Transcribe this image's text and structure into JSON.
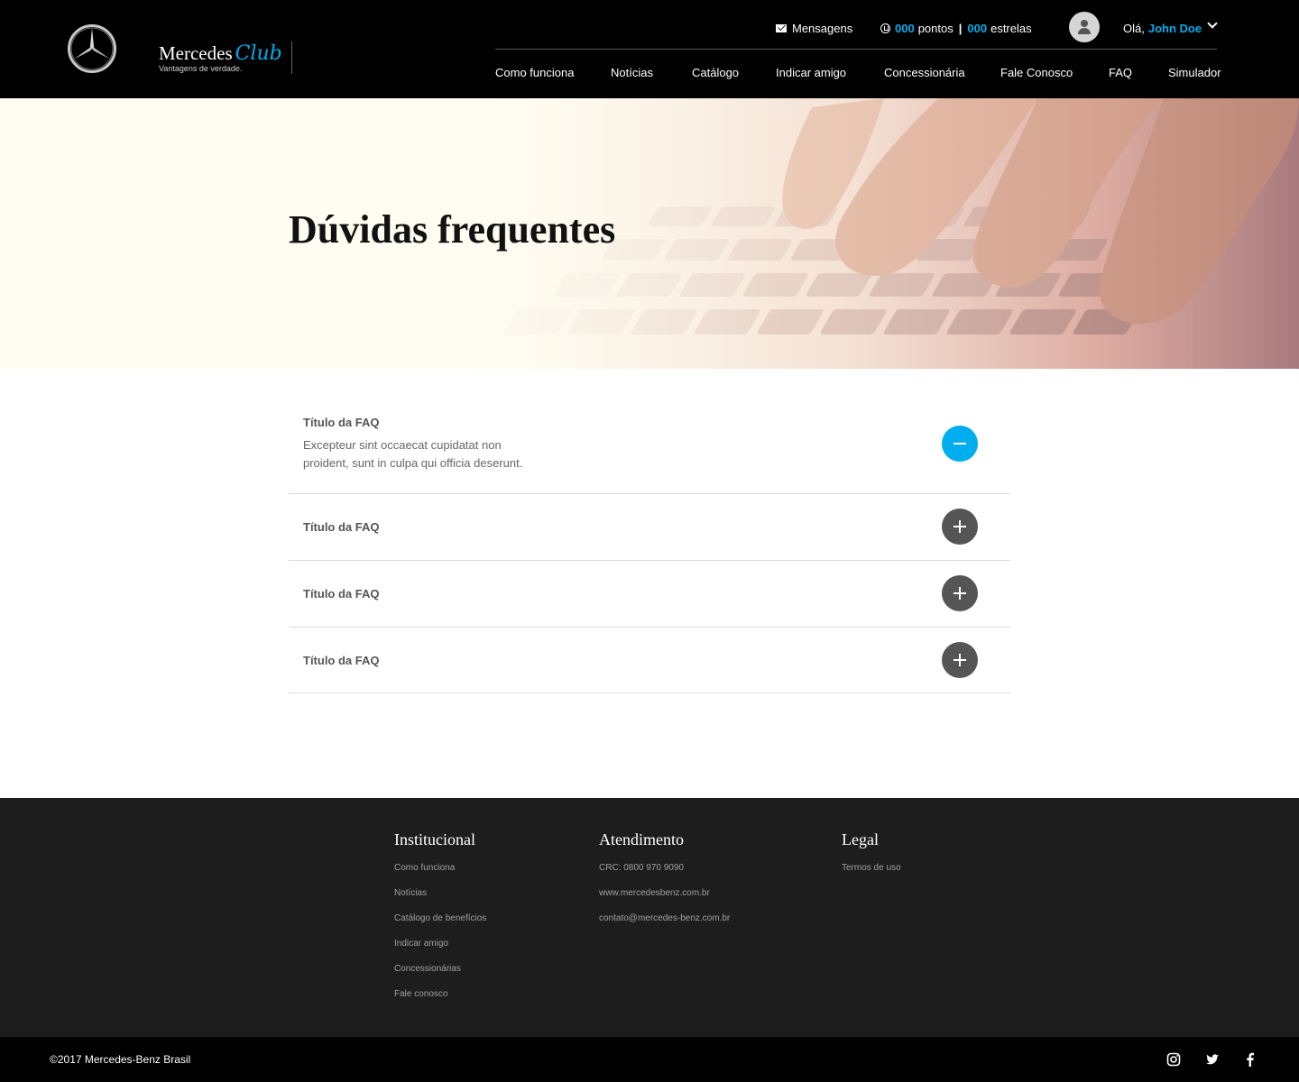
{
  "header": {
    "brand_name": "Mercedes",
    "brand_club": "Club",
    "brand_tagline": "Vantagens de verdade.",
    "messages_label": "Mensagens",
    "points_value": "000",
    "points_label": "pontos",
    "separator": "|",
    "stars_value": "000",
    "stars_label": "estrelas",
    "greeting": "Olá,",
    "user_name": "John Doe",
    "nav": [
      "Como funciona",
      "Notícias",
      "Catálogo",
      "Indicar amigo",
      "Concessionária",
      "Fale Conosco",
      "FAQ",
      "Simulador"
    ]
  },
  "hero": {
    "title": "Dúvidas frequentes"
  },
  "faq": [
    {
      "title": "Título da FAQ",
      "answer": "Excepteur sint occaecat cupidatat non proident, sunt in culpa qui officia deserunt.",
      "state": "open"
    },
    {
      "title": "Título da FAQ",
      "state": "closed"
    },
    {
      "title": "Título da FAQ",
      "state": "closed"
    },
    {
      "title": "Título da FAQ",
      "state": "closed"
    }
  ],
  "footer": {
    "institucional": {
      "heading": "Institucional",
      "links": [
        "Como funciona",
        "Notícias",
        "Catálogo de benefícios",
        "Indicar amigo",
        "Concessionárias",
        "Fale conosco"
      ]
    },
    "atendimento": {
      "heading": "Atendimento",
      "links": [
        "CRC: 0800 970 9090",
        "www.mercedesbenz.com.br",
        "contato@mercedes-benz.com.br"
      ]
    },
    "legal": {
      "heading": "Legal",
      "links": [
        "Termos de uso"
      ]
    },
    "copyright": "©2017 Mercedes-Benz Brasil"
  },
  "colors": {
    "accent": "#00adef",
    "header_bg": "#000000",
    "footer_bg": "#1d1d1d",
    "closed_button": "#555555"
  },
  "icons": {
    "logo": "mercedes-star-icon",
    "messages": "envelope-icon",
    "points": "points-icon",
    "avatar": "user-icon",
    "dropdown": "chevron-down-icon",
    "faq_open": "minus-icon",
    "faq_closed": "plus-icon",
    "social": [
      "instagram-icon",
      "twitter-icon",
      "facebook-icon"
    ]
  }
}
